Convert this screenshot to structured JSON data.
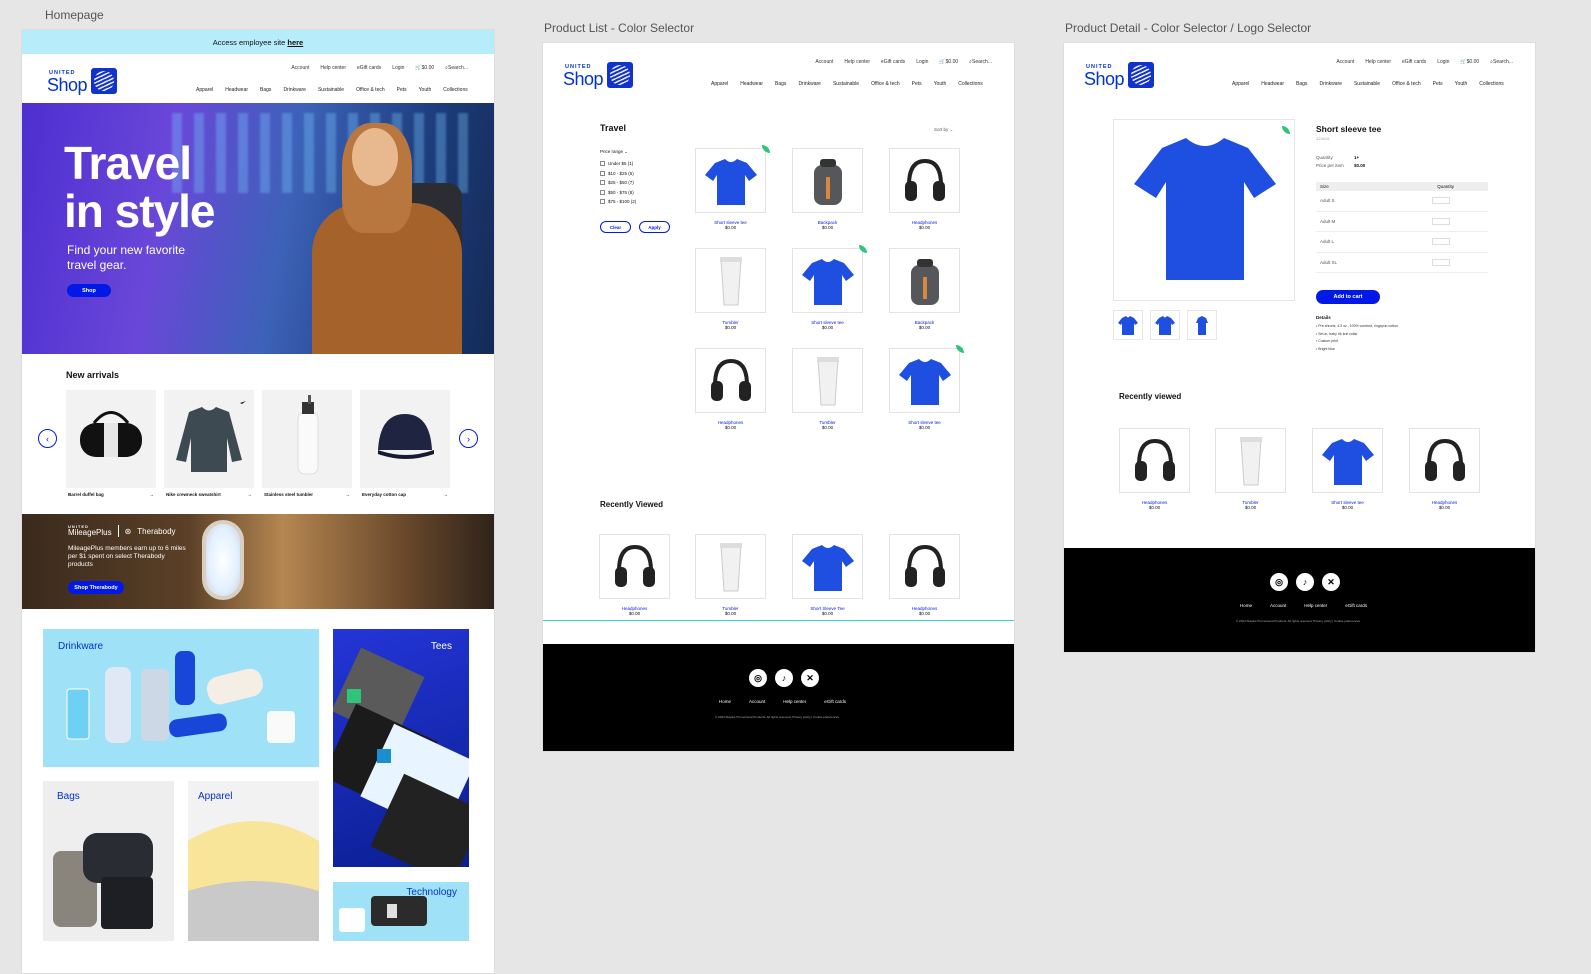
{
  "frames": {
    "homepage": "Homepage",
    "product_list": "Product List - Color Selector",
    "product_detail": "Product Detail - Color Selector / Logo Selector"
  },
  "header": {
    "logo_small": "UNITED",
    "logo_big": "Shop",
    "top_links": [
      "Account",
      "Help center",
      "eGift cards",
      "Login",
      "$0.00",
      "Search..."
    ],
    "nav": [
      "Apparel",
      "Headwear",
      "Bags",
      "Drinkware",
      "Sustainable",
      "Office & tech",
      "Pets",
      "Youth",
      "Collections"
    ]
  },
  "homepage": {
    "banner_text": "Access employee site ",
    "banner_link": "here",
    "hero_title_1": "Travel",
    "hero_title_2": "in style",
    "hero_sub": "Find your new favorite travel gear.",
    "hero_button": "Shop",
    "new_arrivals_title": "New arrivals",
    "arrivals": [
      {
        "name": "Barrel duffel bag",
        "icon": "duffel-bag-icon"
      },
      {
        "name": "Nike crewneck sweatshirt",
        "icon": "sweatshirt-icon"
      },
      {
        "name": "Stainless steel tumbler",
        "icon": "bottle-icon"
      },
      {
        "name": "Everyday cotton cap",
        "icon": "cap-icon"
      }
    ],
    "promo": {
      "brand_1": "MileagePlus",
      "brand_small": "UNITED",
      "brand_2": "Therabody",
      "text": "MileagePlus members earn up to 6 miles per $1 spent on select Therabody products",
      "button": "Shop Therabody"
    },
    "tiles": [
      "Drinkware",
      "Tees",
      "Bags",
      "Apparel",
      "Technology"
    ]
  },
  "product_list": {
    "title": "Travel",
    "sort_label": "Sort by",
    "filter_title": "Price range",
    "filters": [
      "Under $5 (1)",
      "$10 - $25 (5)",
      "$25 - $50 (7)",
      "$50 - $75 (8)",
      "$75 - $100 (2)"
    ],
    "clear_button": "Clear",
    "apply_button": "Apply",
    "products": [
      {
        "name": "Short sleeve tee",
        "price": "$0.00"
      },
      {
        "name": "Backpack",
        "price": "$0.00"
      },
      {
        "name": "Headphones",
        "price": "$0.00"
      },
      {
        "name": "Tumbler",
        "price": "$0.00"
      },
      {
        "name": "Short sleeve tee",
        "price": "$0.00"
      },
      {
        "name": "Backpack",
        "price": "$0.00"
      },
      {
        "name": "Headphones",
        "price": "$0.00"
      },
      {
        "name": "Tumbler",
        "price": "$0.00"
      },
      {
        "name": "Short sleeve tee",
        "price": "$0.00"
      }
    ],
    "recently_viewed_title": "Recently Viewed",
    "recent": [
      {
        "name": "Headphones",
        "price": "$0.00"
      },
      {
        "name": "Tumbler",
        "price": "$0.00"
      },
      {
        "name": "Short Sleeve Tee",
        "price": "$0.00"
      },
      {
        "name": "Headphones",
        "price": "$0.00"
      }
    ]
  },
  "product_detail": {
    "title": "Short sleeve tee",
    "sku": "123415",
    "quantity_label": "Quantity",
    "quantity_value": "1+",
    "price_label": "Price per item",
    "price_value": "$0.00",
    "size_header": "Size",
    "qty_header": "Quantity",
    "sizes": [
      "Adult S",
      "Adult M",
      "Adult L",
      "Adult XL"
    ],
    "add_to_cart": "Add to cart",
    "details_title": "Details",
    "details": [
      "Pre-shrunk, 4.3 oz., 100% combed, ringspun cotton",
      "Set-in, baby rib knit collar",
      "Custom print",
      "Bright blue"
    ],
    "recently_viewed_title": "Recently viewed",
    "recent": [
      {
        "name": "Headphones",
        "price": "$0.00"
      },
      {
        "name": "Tumbler",
        "price": "$0.00"
      },
      {
        "name": "Short sleeve tee",
        "price": "$0.00"
      },
      {
        "name": "Headphones",
        "price": "$0.00"
      }
    ]
  },
  "footer": {
    "social": [
      "instagram-icon",
      "tiktok-icon",
      "x-icon"
    ],
    "links": [
      "Home",
      "Account",
      "Help center",
      "eGift cards"
    ],
    "copyright": "© 2024 Staples Promotional Products. All rights reserved. Privacy policy | Cookie preferences"
  },
  "colors": {
    "accent": "#0019e6",
    "brand_blue": "#0033cc",
    "banner": "#b7ecfb",
    "eco_leaf": "#2fc47a",
    "tee_blue": "#1e4fe0"
  }
}
